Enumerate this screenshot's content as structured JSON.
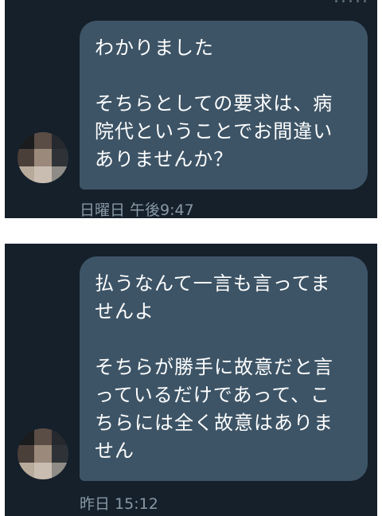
{
  "messages": [
    {
      "lines": [
        "わかりました",
        "",
        "そちらとしての要求は、病",
        "院代ということでお間違い",
        "ありませんか？"
      ],
      "timestamp": "日曜日 午後9:47"
    },
    {
      "lines": [
        "払うなんて一言も言ってま",
        "せんよ",
        "",
        "そちらが勝手に故意だと言",
        "っているだけであって、こ",
        "ちらには全く故意はありま",
        "せん"
      ],
      "timestamp": "昨日 15:12"
    }
  ],
  "colors": {
    "background": "#15202b",
    "bubble": "#3d5466",
    "text": "#ffffff",
    "timestamp": "#8899a6",
    "divider": "#ffffff"
  },
  "icons": [
    "avatar-icon"
  ]
}
